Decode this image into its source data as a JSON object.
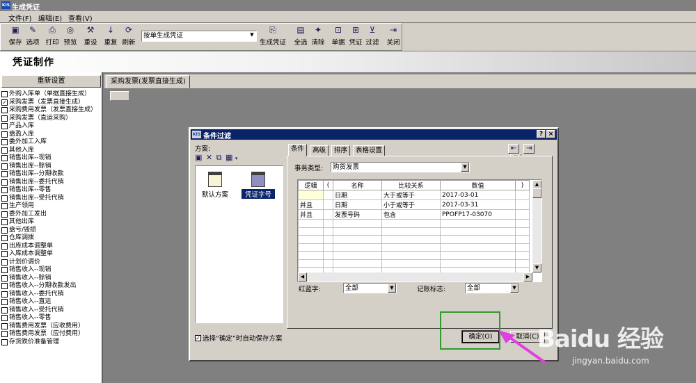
{
  "window": {
    "title": "生成凭证",
    "icon": "KIS"
  },
  "menu": [
    "文件(F)",
    "编辑(E)",
    "查看(V)"
  ],
  "toolbar": {
    "buttons": [
      {
        "label": "保存",
        "icon": "save-icon"
      },
      {
        "label": "选项",
        "icon": "options-icon"
      },
      {
        "label": "打印",
        "icon": "print-icon"
      },
      {
        "label": "预览",
        "icon": "preview-icon"
      },
      {
        "label": "重设",
        "icon": "reset-icon"
      },
      {
        "label": "重复",
        "icon": "repeat-icon"
      },
      {
        "label": "刷新",
        "icon": "refresh-icon"
      }
    ],
    "mode_select": "按单生成凭证",
    "buttons2": [
      {
        "label": "生成凭证",
        "icon": "generate-icon"
      },
      {
        "label": "全选",
        "icon": "select-all-icon"
      },
      {
        "label": "清除",
        "icon": "clear-icon"
      },
      {
        "label": "单据",
        "icon": "document-icon"
      },
      {
        "label": "凭证",
        "icon": "voucher-icon"
      },
      {
        "label": "过滤",
        "icon": "filter-icon"
      },
      {
        "label": "关闭",
        "icon": "close-icon"
      }
    ]
  },
  "banner": {
    "title": "凭证制作"
  },
  "sidebar": {
    "reset_label": "重新设置",
    "items": [
      {
        "label": "外购入库单（单据直接生成）",
        "checked": false
      },
      {
        "label": "采购发票（发票直接生成）",
        "checked": true
      },
      {
        "label": "采购费用发票（发票直接生成）",
        "checked": false
      },
      {
        "label": "采购发票（直运采购）",
        "checked": false
      },
      {
        "label": "产品入库",
        "checked": false
      },
      {
        "label": "盘盈入库",
        "checked": false
      },
      {
        "label": "委外加工入库",
        "checked": false
      },
      {
        "label": "其他入库",
        "checked": false
      },
      {
        "label": "销售出库--现销",
        "checked": false
      },
      {
        "label": "销售出库--赊销",
        "checked": false
      },
      {
        "label": "销售出库--分期收款",
        "checked": false
      },
      {
        "label": "销售出库--委托代销",
        "checked": false
      },
      {
        "label": "销售出库--零售",
        "checked": false
      },
      {
        "label": "销售出库--受托代销",
        "checked": false
      },
      {
        "label": "生产领用",
        "checked": false
      },
      {
        "label": "委外加工发出",
        "checked": false
      },
      {
        "label": "其他出库",
        "checked": false
      },
      {
        "label": "盘亏/毁损",
        "checked": false
      },
      {
        "label": "仓库调拨",
        "checked": false
      },
      {
        "label": "出库成本调整单",
        "checked": false
      },
      {
        "label": "入库成本调整单",
        "checked": false
      },
      {
        "label": "计划价调价",
        "checked": false
      },
      {
        "label": "销售收入--现销",
        "checked": false
      },
      {
        "label": "销售收入--赊销",
        "checked": false
      },
      {
        "label": "销售收入--分期收款发出",
        "checked": false
      },
      {
        "label": "销售收入--委托代销",
        "checked": false
      },
      {
        "label": "销售收入--直运",
        "checked": false
      },
      {
        "label": "销售收入--受托代销",
        "checked": false
      },
      {
        "label": "销售收入--零售",
        "checked": false
      },
      {
        "label": "销售费用发票（应收费用）",
        "checked": false
      },
      {
        "label": "销售费用发票（应付费用）",
        "checked": false
      },
      {
        "label": "存货跌价准备管理",
        "checked": false
      }
    ]
  },
  "doc_tab": "采购发票(发票直接生成)",
  "dialog": {
    "title": "条件过滤",
    "help": "?",
    "close": "×",
    "scheme_label": "方案:",
    "schemes": [
      "默认方案",
      "凭证字号"
    ],
    "tabs": [
      "条件",
      "高级",
      "排序",
      "表格设置"
    ],
    "business_type_label": "事务类型:",
    "business_type_value": "购货发票",
    "grid_headers": [
      "逻辑",
      "(",
      "名称",
      "比较关系",
      "数值",
      ")"
    ],
    "grid_rows": [
      [
        "",
        "",
        "日期",
        "大于或等于",
        "2017-03-01",
        ""
      ],
      [
        "并且",
        "",
        "日期",
        "小于或等于",
        "2017-03-31",
        ""
      ],
      [
        "并且",
        "",
        "发票号码",
        "包含",
        "PPOFP17-03070",
        ""
      ]
    ],
    "red_blue_label": "红蓝字:",
    "red_blue_value": "全部",
    "posting_label": "记账标志:",
    "posting_value": "全部",
    "autosave_label": "选择“确定”时自动保存方案",
    "autosave_checked": true,
    "ok_label": "确定(O)",
    "cancel_label": "取消(C)"
  },
  "watermark": {
    "brand": "Baidu 经验",
    "url": "jingyan.baidu.com"
  },
  "colors": {
    "title_active": "#0a246a",
    "face": "#d4d0c8",
    "highlight_box": "#2e9a2e",
    "arrow": "#e040e0"
  }
}
